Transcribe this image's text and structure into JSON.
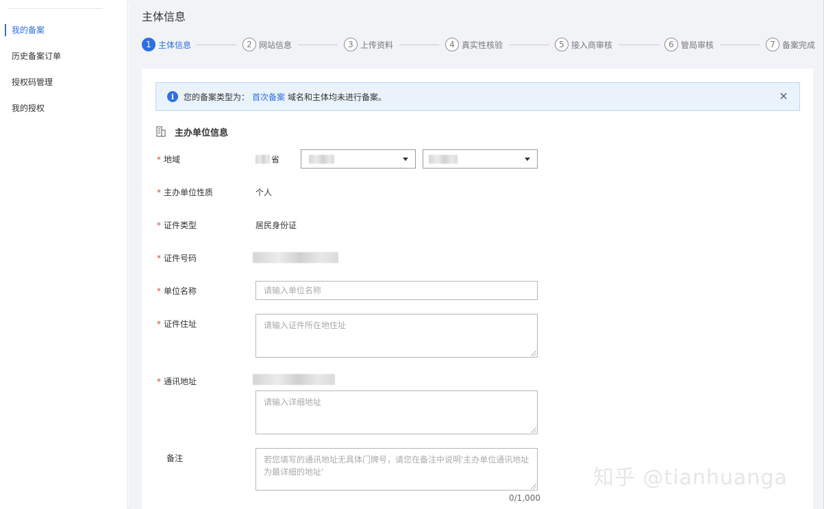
{
  "sidebar": {
    "items": [
      {
        "label": "我的备案",
        "active": true
      },
      {
        "label": "历史备案订单",
        "active": false
      },
      {
        "label": "授权码管理",
        "active": false
      },
      {
        "label": "我的授权",
        "active": false
      }
    ]
  },
  "main": {
    "title": "主体信息",
    "steps": [
      {
        "num": "1",
        "label": "主体信息",
        "active": true
      },
      {
        "num": "2",
        "label": "网站信息",
        "active": false
      },
      {
        "num": "3",
        "label": "上传资料",
        "active": false
      },
      {
        "num": "4",
        "label": "真实性核验",
        "active": false
      },
      {
        "num": "5",
        "label": "接入商审核",
        "active": false
      },
      {
        "num": "6",
        "label": "管局审核",
        "active": false
      },
      {
        "num": "7",
        "label": "备案完成",
        "active": false
      }
    ]
  },
  "alert": {
    "prefix": "您的备案类型为：",
    "link": "首次备案",
    "suffix": "域名和主体均未进行备案。",
    "info_icon": "info-icon",
    "close_icon": "close-icon"
  },
  "section": {
    "title": "主办单位信息",
    "icon": "building-icon"
  },
  "form": {
    "region": {
      "label": "地域",
      "province_suffix": "省"
    },
    "org_type": {
      "label": "主办单位性质",
      "value": "个人"
    },
    "id_type": {
      "label": "证件类型",
      "value": "居民身份证"
    },
    "id_number": {
      "label": "证件号码"
    },
    "org_name": {
      "label": "单位名称",
      "placeholder": "请输入单位名称"
    },
    "id_address": {
      "label": "证件住址",
      "placeholder": "请输入证件所在地住址"
    },
    "contact_address": {
      "label": "通讯地址",
      "placeholder": "请输入详细地址"
    },
    "remark": {
      "label": "备注",
      "placeholder": "若您填写的通讯地址无具体门牌号，请您在备注中说明'主办单位通讯地址为最详细的地址'",
      "counter": "0/1,000"
    },
    "required_mark": "*"
  },
  "watermark": "知乎 @tianhuanga",
  "colors": {
    "accent": "#2f6fe0",
    "required": "#e0433d",
    "alert_bg": "#eaf3fc"
  }
}
